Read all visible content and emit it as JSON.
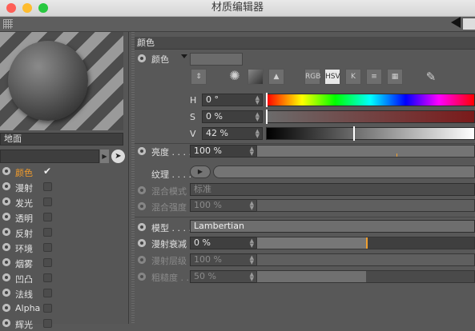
{
  "window": {
    "title": "材质编辑器",
    "traffic": {
      "close": "#fe5f57",
      "minimize": "#febc2e",
      "zoom": "#28c840"
    }
  },
  "left": {
    "material_name": "地面",
    "channels": [
      {
        "label": "颜色",
        "checked": true,
        "active": true
      },
      {
        "label": "漫射",
        "checked": false
      },
      {
        "label": "发光",
        "checked": false
      },
      {
        "label": "透明",
        "checked": false
      },
      {
        "label": "反射",
        "checked": false
      },
      {
        "label": "环境",
        "checked": false
      },
      {
        "label": "烟雾",
        "checked": false
      },
      {
        "label": "凹凸",
        "checked": false
      },
      {
        "label": "法线",
        "checked": false
      },
      {
        "label": "Alpha",
        "checked": false
      },
      {
        "label": "辉光",
        "checked": false
      }
    ]
  },
  "right": {
    "section_title": "颜色",
    "color": {
      "label": "颜色",
      "swatch": "#6b6b6b"
    },
    "modes": [
      "RGB",
      "HSV",
      "K"
    ],
    "hsv": {
      "h_label": "H",
      "h_value": "0 °",
      "s_label": "S",
      "s_value": "0 %",
      "v_label": "V",
      "v_value": "42 %",
      "v_level": 0.42
    },
    "brightness": {
      "label": "亮度 . . . .",
      "value": "100 %",
      "level": 1.0
    },
    "texture": {
      "label": "纹理 . . . ."
    },
    "blend_mode": {
      "label": "混合模式",
      "value": "标准"
    },
    "blend_strength": {
      "label": "混合强度",
      "value": "100 %",
      "level": 1.0
    },
    "model": {
      "label": "模型 . . . .",
      "value": "Lambertian"
    },
    "diffuse_falloff": {
      "label": "漫射衰减",
      "value": "0 %",
      "level": 0.5
    },
    "diffuse_level": {
      "label": "漫射层级",
      "value": "100 %",
      "level": 1.0
    },
    "roughness": {
      "label": "粗糙度 . .",
      "value": "50 %",
      "level": 0.5
    },
    "accent": "#f0a030"
  }
}
